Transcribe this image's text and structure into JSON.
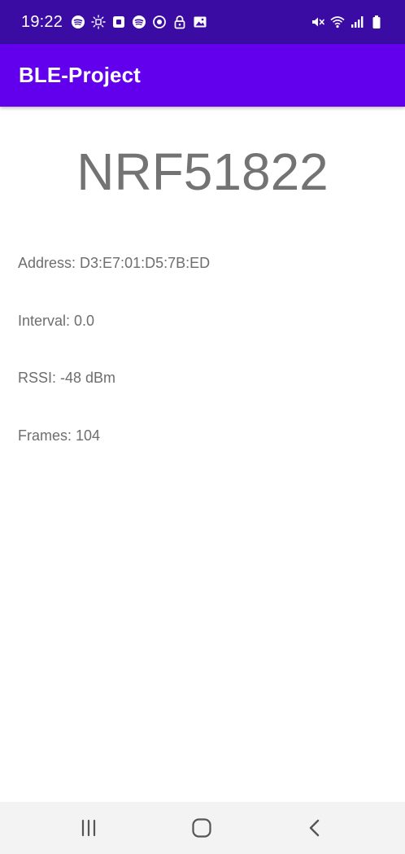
{
  "status_bar": {
    "time": "19:22",
    "background": "#3a0ca3",
    "left_icons": [
      "spotify-icon",
      "brightness-icon",
      "square-app-icon",
      "spotify-icon",
      "sync-icon",
      "lock-icon",
      "image-icon"
    ],
    "right_icons": [
      "mute-icon",
      "wifi-icon",
      "signal-icon",
      "battery-icon"
    ]
  },
  "app_bar": {
    "title": "BLE-Project",
    "background": "#6200ee"
  },
  "device": {
    "name": "NRF51822",
    "address": "Address: D3:E7:01:D5:7B:ED",
    "interval": "Interval: 0.0",
    "rssi": "RSSI: -48 dBm",
    "frames": "Frames: 104"
  },
  "nav_bar": {
    "buttons": [
      "recents-icon",
      "home-icon",
      "back-icon"
    ]
  }
}
